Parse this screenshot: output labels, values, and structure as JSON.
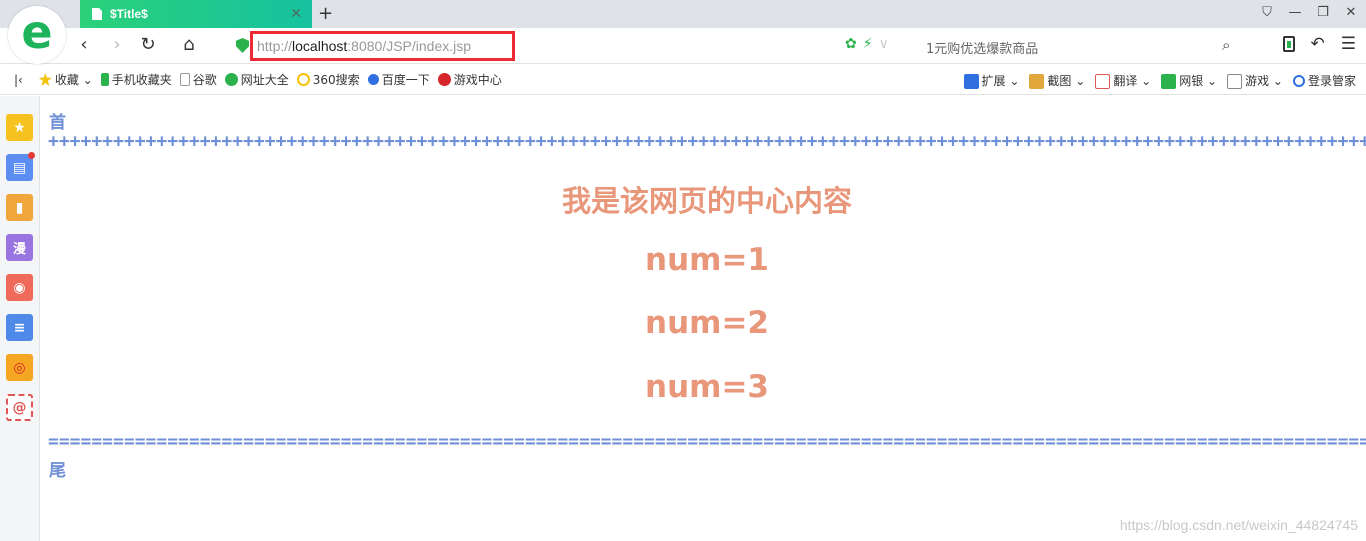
{
  "browser": {
    "tab_title": "$Title$",
    "tab_close": "✕",
    "new_tab": "+",
    "url_prefix": "http://",
    "url_host": "localhost",
    "url_rest": ":8080/JSP/index.jsp",
    "promo_text": "1元购优选爆款商品",
    "accent_color": "#2bd179",
    "highlight_color": "#ee2a34"
  },
  "bookmarks": {
    "items": [
      {
        "label": "收藏",
        "icon": "star-icon",
        "color": "#f4c20d"
      },
      {
        "label": "手机收藏夹",
        "icon": "phone-icon",
        "color": "#2bb24c"
      },
      {
        "label": "谷歌",
        "icon": "page-icon",
        "color": "#cccccc"
      },
      {
        "label": "网址大全",
        "icon": "globe-icon",
        "color": "#2bb24c"
      },
      {
        "label": "360搜索",
        "icon": "search-360-icon",
        "color": "#f4c20d"
      },
      {
        "label": "百度一下",
        "icon": "baidu-paw-icon",
        "color": "#2f6fe0"
      },
      {
        "label": "游戏中心",
        "icon": "game-center-icon",
        "color": "#d6262b"
      }
    ],
    "right_items": [
      {
        "label": "扩展",
        "icon": "extension-icon",
        "color": "#2f6fe0"
      },
      {
        "label": "截图",
        "icon": "screenshot-icon",
        "color": "#e2a73a"
      },
      {
        "label": "翻译",
        "icon": "translate-icon",
        "color": "#e05555"
      },
      {
        "label": "网银",
        "icon": "bank-shield-icon",
        "color": "#2bb24c"
      },
      {
        "label": "游戏",
        "icon": "gamepad-icon",
        "color": "#888888"
      },
      {
        "label": "登录管家",
        "icon": "login-search-icon",
        "color": "#2f6fe0"
      }
    ]
  },
  "sidebar": {
    "items": [
      {
        "icon": "favorites-star-icon",
        "color": "#f6c21f",
        "glyph": "★"
      },
      {
        "icon": "news-icon",
        "color": "#5b8ef0",
        "glyph": "▤"
      },
      {
        "icon": "bookmark-book-icon",
        "color": "#f0a63b",
        "glyph": "▮"
      },
      {
        "icon": "manga-icon",
        "color": "#9a74e0",
        "glyph": "漫"
      },
      {
        "icon": "game-controller-icon",
        "color": "#ef6a5a",
        "glyph": "◉"
      },
      {
        "icon": "document-icon",
        "color": "#4f8ae8",
        "glyph": "≡"
      },
      {
        "icon": "weibo-icon",
        "color": "#f5a623",
        "glyph": "◎"
      },
      {
        "icon": "mail-at-icon",
        "color": "#ffffff",
        "glyph": "@"
      }
    ]
  },
  "page": {
    "head": "首",
    "plus_line": "++++++++++++++++++++++++++++++++++++++++++++++++++++++++++++++++++++++++++++++++++++++++++++++++++++++++++++++++++++++++++++++++++++++++++++++++++++++++++++++++++++++++++++++++++++++++++++",
    "center_title": "我是该网页的中心内容",
    "nums": [
      "num=1",
      "num=2",
      "num=3"
    ],
    "eq_line": "=====================================================================================================================================================================================================",
    "foot": "尾",
    "watermark": "https://blog.csdn.net/weixin_44824745"
  }
}
